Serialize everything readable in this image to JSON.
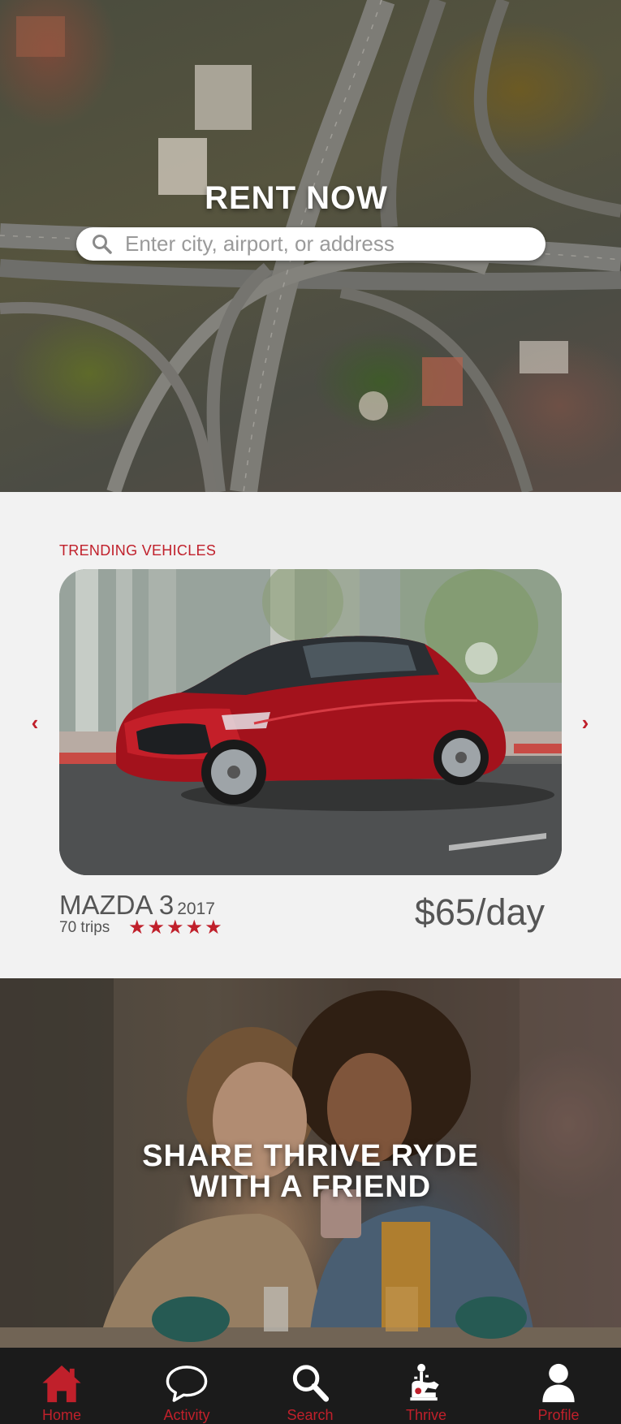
{
  "hero": {
    "title": "RENT NOW",
    "search_placeholder": "Enter city, airport, or address",
    "search_value": ""
  },
  "trending": {
    "section_label": "TRENDING VEHICLES",
    "vehicle": {
      "model": "MAZDA 3",
      "year": "2017",
      "trips": "70 trips",
      "rating": 5,
      "rating_stars": "★★★★★",
      "price": "$65/day"
    },
    "prev_arrow": "‹",
    "next_arrow": "›"
  },
  "promo": {
    "title_line1": "SHARE THRIVE RYDE",
    "title_line2": "WITH A FRIEND"
  },
  "bottom_nav": {
    "items": [
      {
        "label": "Home",
        "icon": "home-icon"
      },
      {
        "label": "Activity",
        "icon": "speech-bubble-icon"
      },
      {
        "label": "Search",
        "icon": "search-icon"
      },
      {
        "label": "Thrive",
        "icon": "thrive-icon"
      },
      {
        "label": "Profile",
        "icon": "profile-icon"
      }
    ]
  },
  "colors": {
    "accent": "#c0202b",
    "nav_background": "#1b1b1b",
    "section_background": "#f2f2f2"
  }
}
